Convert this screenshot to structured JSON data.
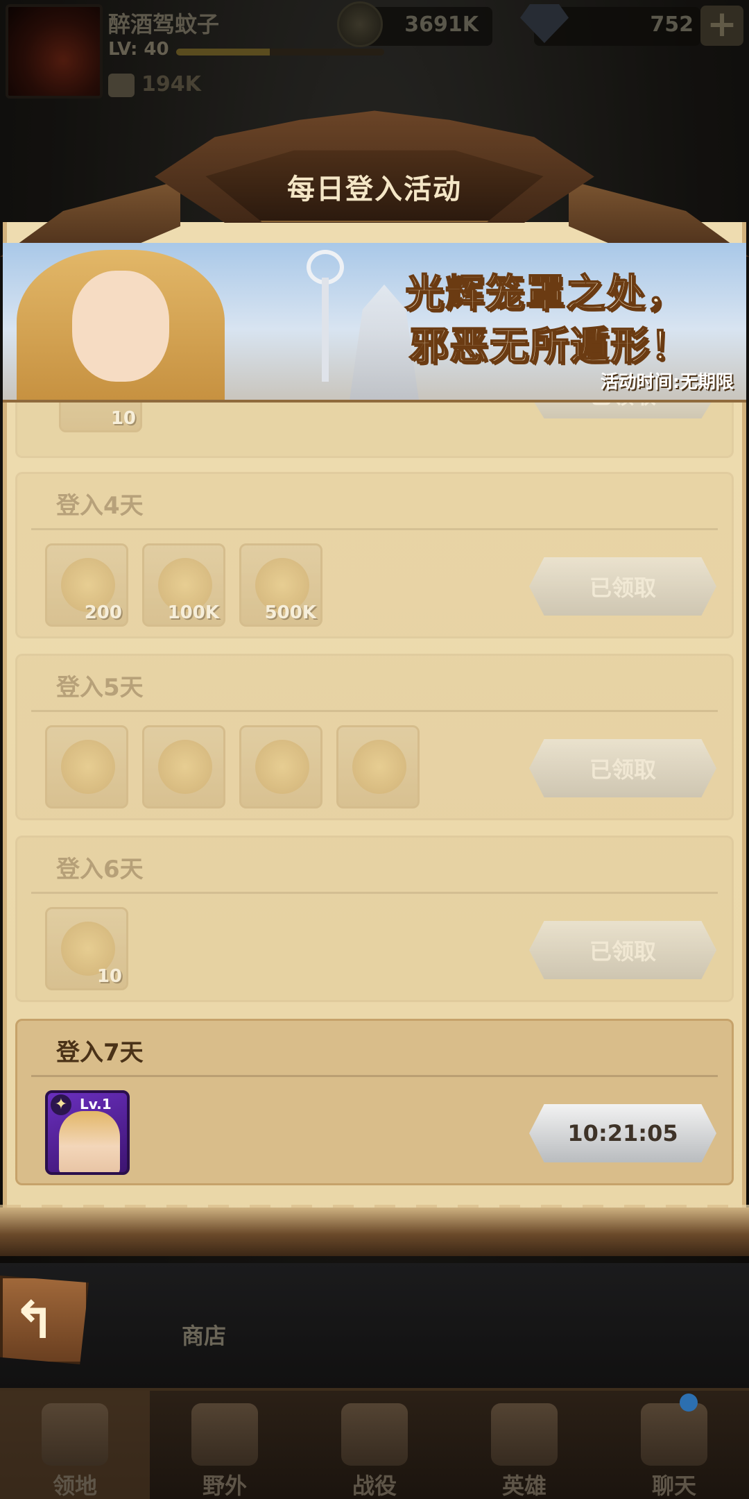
{
  "player": {
    "name": "醉酒驾蚊子",
    "level_label": "LV: 40",
    "xp_fraction": 0.45,
    "power": "194K"
  },
  "resources": {
    "coins": "3691K",
    "gems": "752",
    "add_label": "+"
  },
  "modal": {
    "title": "每日登入活动",
    "banner": {
      "slogan_line1": "光辉笼罩之处，",
      "slogan_line2": "邪恶无所遁形！",
      "time": "活动时间:无期限"
    },
    "partial_row": {
      "item_qty": "10",
      "button": "已领取"
    },
    "rows": [
      {
        "title": "登入4天",
        "items": [
          {
            "icon": "ore-icon",
            "qty": "200"
          },
          {
            "icon": "hero-essence-icon",
            "qty": "100K"
          },
          {
            "icon": "gold-coin-icon",
            "qty": "500K"
          }
        ],
        "button": "已领取"
      },
      {
        "title": "登入5天",
        "items": [
          {
            "icon": "staff-icon",
            "qty": ""
          },
          {
            "icon": "gauntlet-icon",
            "qty": ""
          },
          {
            "icon": "armor-icon",
            "qty": ""
          },
          {
            "icon": "boots-icon",
            "qty": ""
          }
        ],
        "button": "已领取"
      },
      {
        "title": "登入6天",
        "items": [
          {
            "icon": "scroll-icon",
            "qty": "10"
          }
        ],
        "button": "已领取"
      },
      {
        "title": "登入7天",
        "hero": {
          "level": "Lv.1"
        },
        "button": "10:21:05"
      }
    ]
  },
  "back": {
    "icon": "back-arrow-icon",
    "shop_label": "商店"
  },
  "nav": [
    {
      "label": "领地",
      "icon": "castle-icon"
    },
    {
      "label": "野外",
      "icon": "map-scroll-icon"
    },
    {
      "label": "战役",
      "icon": "battle-icon"
    },
    {
      "label": "英雄",
      "icon": "hero-helmet-icon"
    },
    {
      "label": "聊天",
      "icon": "chat-icon"
    }
  ]
}
